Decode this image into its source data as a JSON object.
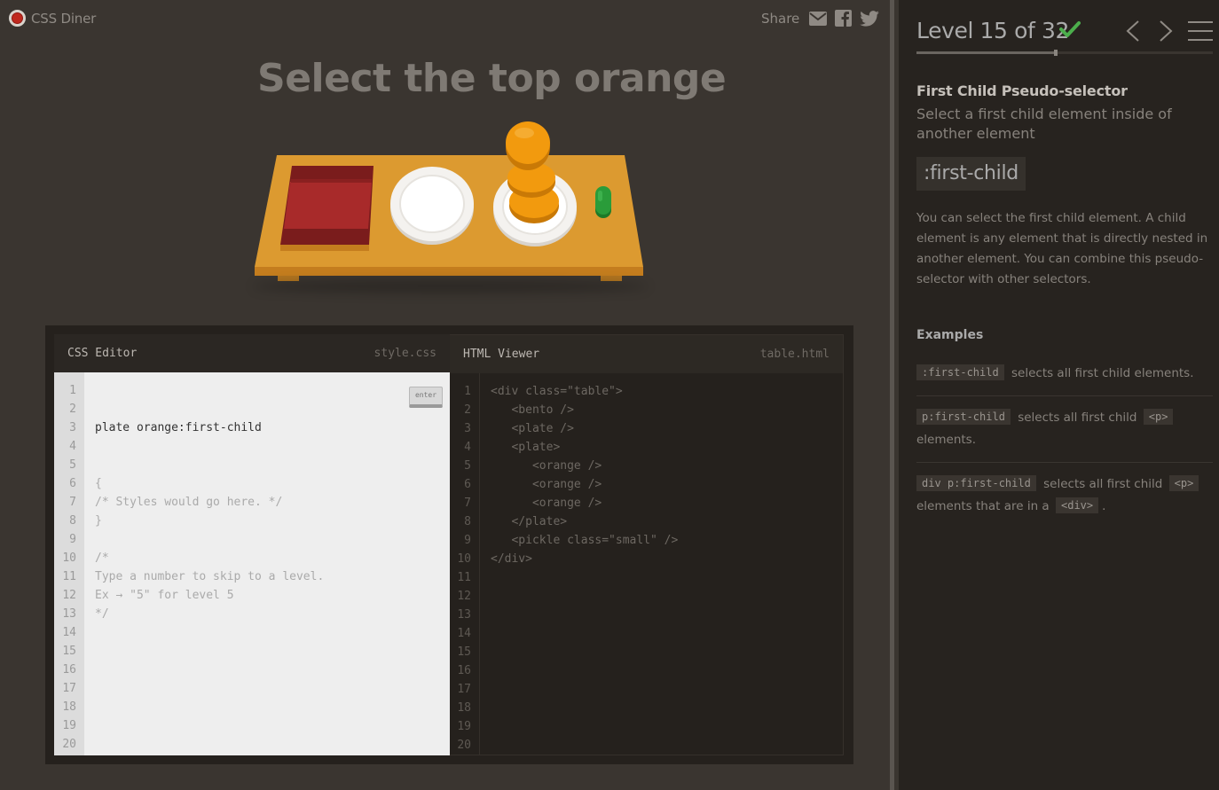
{
  "header": {
    "logo_text": "CSS Diner",
    "share_label": "Share"
  },
  "level": {
    "instruction": "Select the top orange"
  },
  "css_editor": {
    "title": "CSS Editor",
    "filename": "style.css",
    "input_value": "plate orange:first-child",
    "enter_label": "enter",
    "line_numbers": "1\n2\n3\n4\n5\n6\n7\n8\n9\n10\n11\n12\n13\n14\n15\n16\n17\n18\n19\n20",
    "code_after_input": "{\n/* Styles would go here. */\n}\n\n/*\nType a number to skip to a level.\nEx → \"5\" for level 5\n*/"
  },
  "html_viewer": {
    "title": "HTML Viewer",
    "filename": "table.html",
    "line_numbers": "1\n2\n3\n4\n5\n6\n7\n8\n9\n10\n11\n12\n13\n14\n15\n16\n17\n18\n19\n20",
    "code": "<div class=\"table\">\n   <bento />\n   <plate />\n   <plate>\n      <orange />\n      <orange />\n      <orange />\n   </plate>\n   <pickle class=\"small\" />\n</div>"
  },
  "sidebar": {
    "level_indicator": "Level 15 of 32",
    "completed": true,
    "progress": 0.47,
    "selector_name": "First Child Pseudo-selector",
    "selector_subtitle": "Select a first child element inside of another element",
    "syntax": ":first-child",
    "description": "You can select the first child element. A child element is any element that is directly nested in another element. You can combine this pseudo-selector with other selectors.",
    "examples_title": "Examples",
    "examples": [
      {
        "code": ":first-child",
        "text": "selects all first child elements."
      },
      {
        "code": "p:first-child",
        "text_a": "selects all first child",
        "code2": "<p>",
        "text_b": "elements."
      },
      {
        "code": "div p:first-child",
        "text_a": "selects all first child",
        "code2": "<p>",
        "text_b": "elements that are in a",
        "code3": "<div>",
        "text_c": "."
      }
    ]
  },
  "colors": {
    "background": "#3a3530",
    "sidebar": "#27231f",
    "table": "#d8962c",
    "orange": "#f29a0e",
    "bento": "#a12a2a",
    "pickle": "#2a9c3a",
    "check": "#4cae4c"
  },
  "icons": {
    "logo": "red-dot-icon",
    "mail": "envelope-icon",
    "facebook": "facebook-icon",
    "twitter": "twitter-icon",
    "check": "checkmark-icon",
    "prev": "chevron-left-icon",
    "next": "chevron-right-icon",
    "menu": "hamburger-icon"
  }
}
